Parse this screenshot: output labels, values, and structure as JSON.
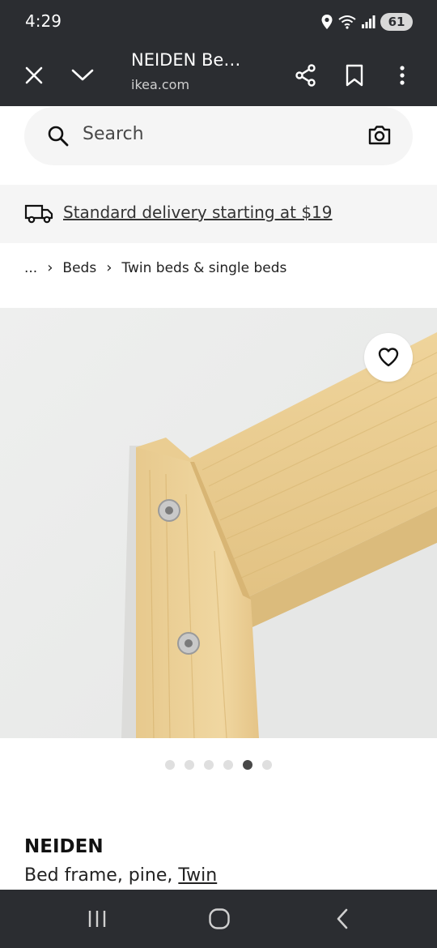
{
  "status_bar": {
    "time": "4:29",
    "battery": "61"
  },
  "toolbar": {
    "title": "NEIDEN Be…",
    "url": "ikea.com"
  },
  "search": {
    "placeholder": "Search"
  },
  "delivery": {
    "text": "Standard delivery starting at $19"
  },
  "breadcrumb": {
    "items": [
      "...",
      "Beds",
      "Twin beds & single beds"
    ]
  },
  "carousel": {
    "total": 6,
    "active_index": 4
  },
  "product": {
    "name": "NEIDEN",
    "description_prefix": "Bed frame, pine, ",
    "size_link": "Twin"
  },
  "colors": {
    "chrome": "#2b2d31",
    "panel": "#f5f5f5",
    "wood": "#e8c98c"
  }
}
